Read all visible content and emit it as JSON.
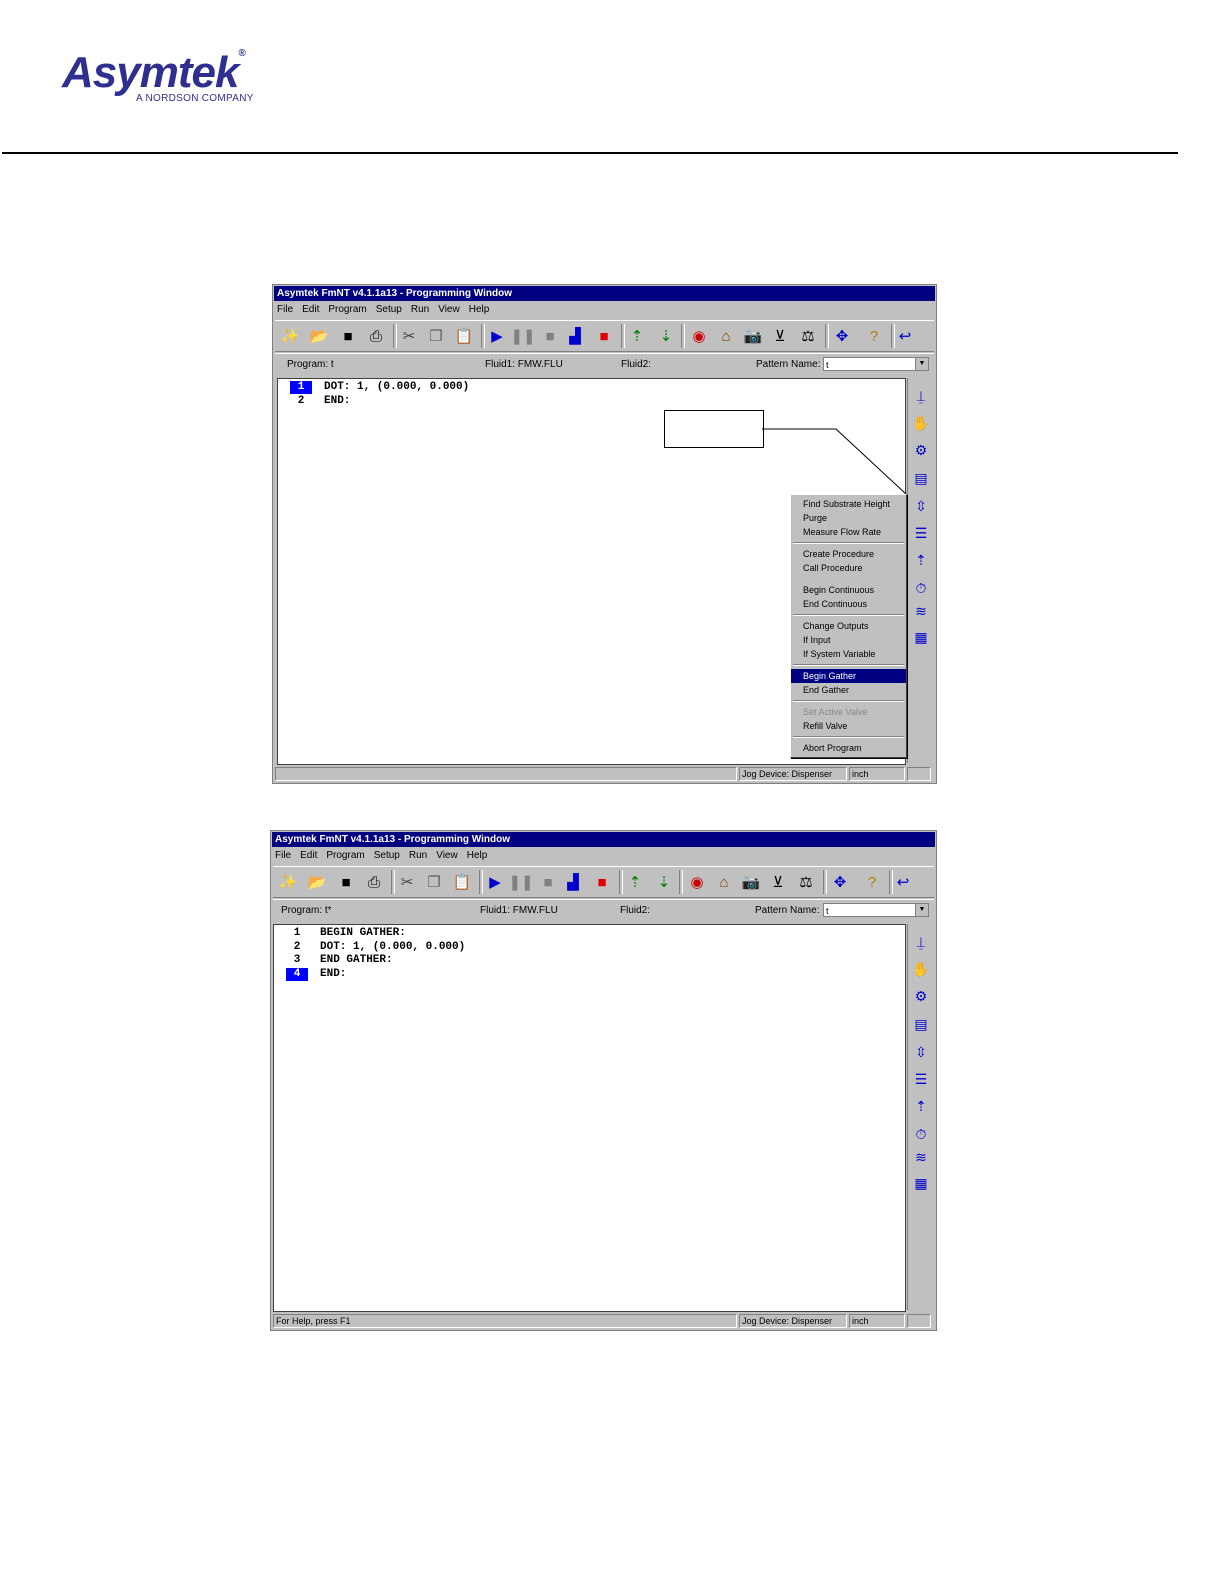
{
  "brand": {
    "name": "Asymtek",
    "registered": "®",
    "tagline": "A NORDSON COMPANY"
  },
  "colors": {
    "title_bar": "#000080",
    "brand": "#2e2f8f",
    "selection": "#0000ff"
  },
  "menu_labels": [
    "File",
    "Edit",
    "Program",
    "Setup",
    "Run",
    "View",
    "Help"
  ],
  "window1": {
    "title": "Asymtek FmNT v4.1.1a13 - Programming Window",
    "program_label": "Program: t",
    "fluid1_label": "Fluid1: FMW.FLU",
    "fluid2_label": "Fluid2:",
    "pattern_label": "Pattern Name:",
    "pattern_value": "t",
    "lines": [
      {
        "num": "1",
        "code": "DOT: 1, (0.000, 0.000)"
      },
      {
        "num": "2",
        "code": "END:"
      }
    ],
    "status": {
      "help": "",
      "jog": "Jog Device: Dispenser",
      "units": "inch"
    }
  },
  "context_menu": {
    "groups": [
      [
        "Find Substrate Height",
        "Purge",
        "Measure Flow Rate"
      ],
      [
        "Create Procedure",
        "Call Procedure",
        "",
        "Begin Continuous",
        "End Continuous"
      ],
      [
        "Change Outputs",
        "If Input",
        "If System Variable"
      ],
      [
        "Begin Gather",
        "End Gather"
      ],
      [
        "Set Active Valve",
        "Refill Valve"
      ],
      [
        "Abort Program"
      ]
    ],
    "selected": "Begin Gather",
    "disabled": "Set Active Valve"
  },
  "window2": {
    "title": "Asymtek FmNT v4.1.1a13 - Programming Window",
    "program_label": "Program: t*",
    "fluid1_label": "Fluid1: FMW.FLU",
    "fluid2_label": "Fluid2:",
    "pattern_label": "Pattern Name:",
    "pattern_value": "t",
    "lines": [
      {
        "num": "1",
        "code": "BEGIN GATHER:"
      },
      {
        "num": "2",
        "code": "DOT: 1, (0.000, 0.000)"
      },
      {
        "num": "3",
        "code": "END GATHER:"
      },
      {
        "num": "4",
        "code": "END:"
      }
    ],
    "status": {
      "help": "For Help, press F1",
      "jog": "Jog Device: Dispenser",
      "units": "inch"
    }
  },
  "toolbar_icons": [
    "wizard-icon",
    "open-folder-icon",
    "save-disk-icon",
    "print-icon",
    "cut-icon",
    "copy-icon",
    "paste-icon",
    "run-icon",
    "pause-icon",
    "stop-gray-icon",
    "step-icon",
    "stop-red-icon",
    "upload-icon",
    "download-icon",
    "fluid-drop-icon",
    "home-icon",
    "camera-icon",
    "needle-icon",
    "scale-icon",
    "move-arrows-icon",
    "help-icon",
    "main-return-icon"
  ],
  "sidebar_icons": [
    "height-sense-icon",
    "purge-icon",
    "flow-rate-icon",
    "procedure-icon",
    "continuous-icon",
    "list-icon",
    "outputs-icon",
    "timer-icon",
    "gather-icon",
    "array-icon"
  ]
}
